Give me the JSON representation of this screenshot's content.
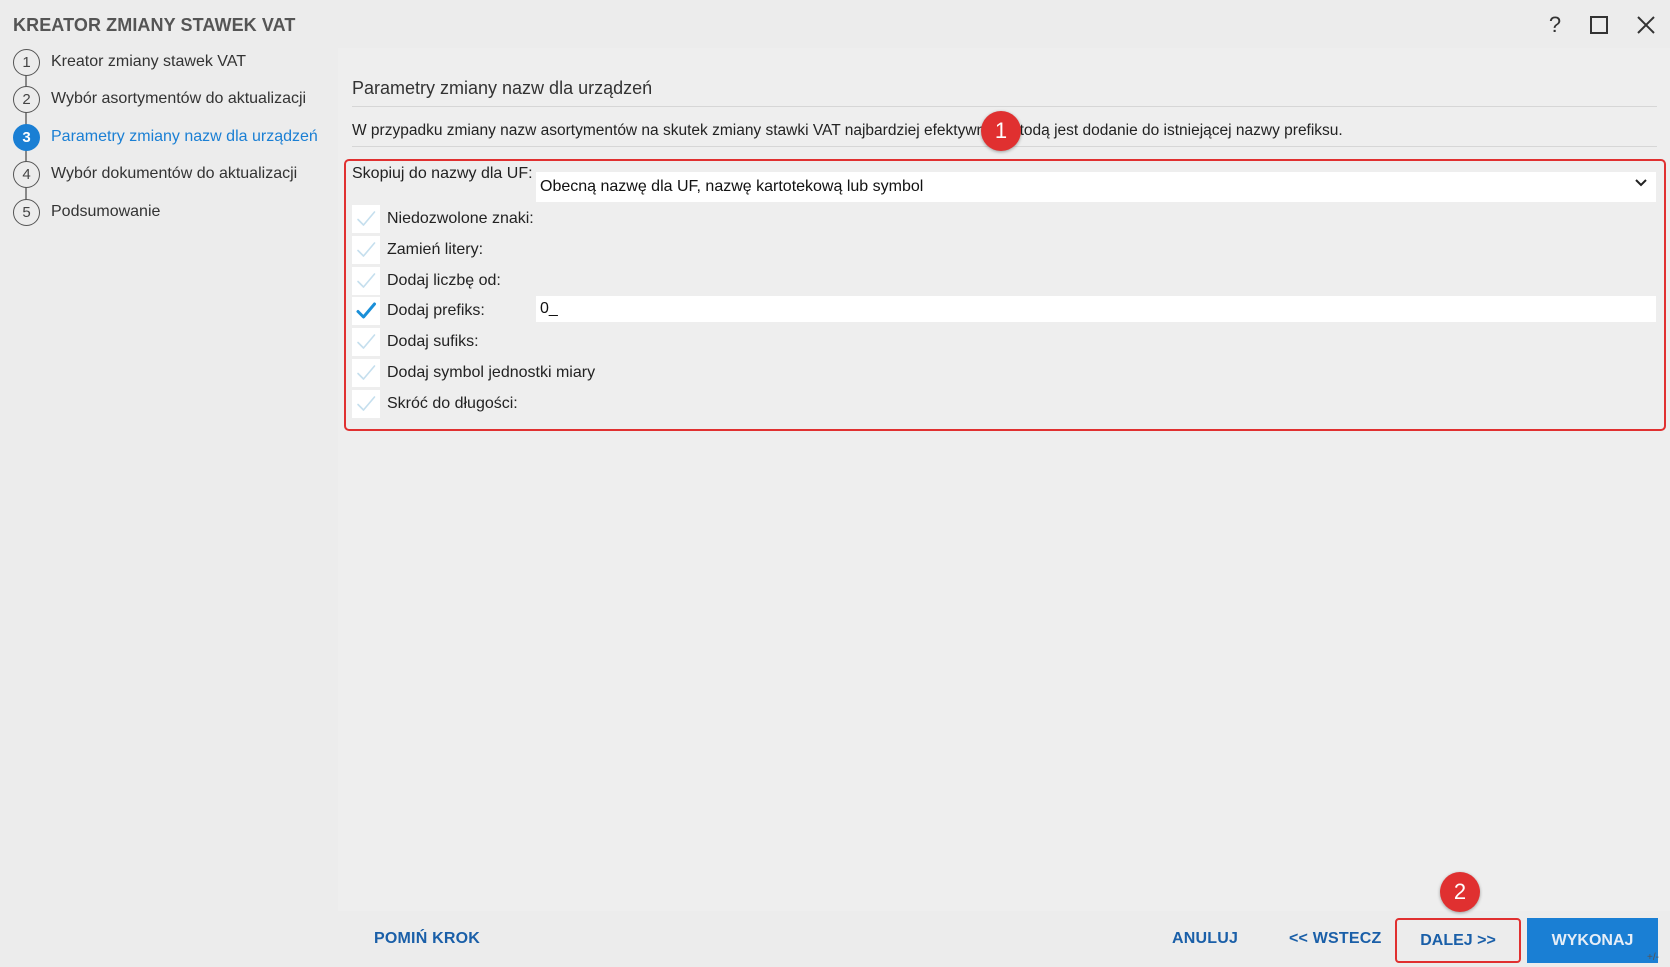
{
  "window": {
    "title": "KREATOR ZMIANY STAWEK VAT",
    "help_symbol": "?",
    "maximize_symbol": "☐",
    "close_symbol": "✕"
  },
  "steps": [
    {
      "num": "1",
      "label": "Kreator zmiany stawek VAT"
    },
    {
      "num": "2",
      "label": "Wybór asortymentów do aktualizacji"
    },
    {
      "num": "3",
      "label": "Parametry zmiany nazw dla urządzeń"
    },
    {
      "num": "4",
      "label": "Wybór dokumentów do aktualizacji"
    },
    {
      "num": "5",
      "label": "Podsumowanie"
    }
  ],
  "active_step": 3,
  "main": {
    "section_title": "Parametry zmiany nazw dla urządzeń",
    "description": "W przypadku zmiany nazw asortymentów na skutek zmiany stawki VAT najbardziej efektywną metodą jest dodanie do istniejącej nazwy prefiksu.",
    "copy_label": "Skopiuj do nazwy dla UF:",
    "copy_value": "Obecną nazwę dla UF, nazwę kartotekową lub symbol",
    "options": [
      {
        "label": "Niedozwolone znaki:",
        "checked": false
      },
      {
        "label": "Zamień litery:",
        "checked": false
      },
      {
        "label": "Dodaj liczbę od:",
        "checked": false
      },
      {
        "label": "Dodaj prefiks:",
        "checked": true
      },
      {
        "label": "Dodaj sufiks:",
        "checked": false
      },
      {
        "label": "Dodaj symbol jednostki miary",
        "checked": false
      },
      {
        "label": "Skróć do długości:",
        "checked": false
      }
    ],
    "prefix_value": "0_"
  },
  "footer": {
    "skip": "POMIŃ KROK",
    "cancel": "ANULUJ",
    "back": "<< WSTECZ",
    "next": "DALEJ >>",
    "execute": "WYKONAJ",
    "corner": "+/-"
  },
  "annotations": {
    "badge1": "1",
    "badge2": "2"
  },
  "colors": {
    "accent": "#1a7fd4",
    "link": "#1a5fa8",
    "highlight": "#e03030",
    "check_on": "#1a8fd8",
    "check_off": "#c5dfee"
  }
}
